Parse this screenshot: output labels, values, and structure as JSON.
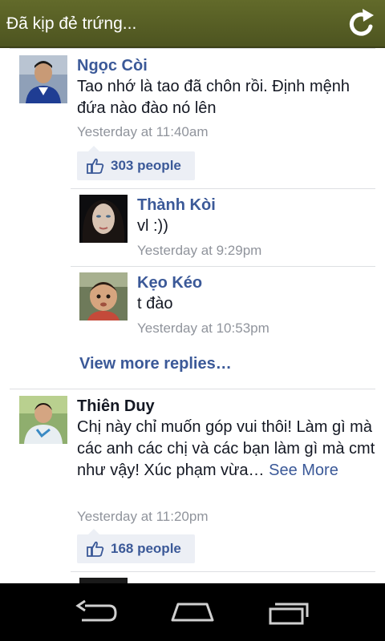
{
  "header": {
    "title": "Đã kịp đẻ trứng...",
    "refresh_icon": "refresh-icon"
  },
  "comments": [
    {
      "name": "Ngọc Còi",
      "text": "Tao nhớ là tao đã chôn rồi. Định mệnh đứa nào đào nó lên",
      "time": "Yesterday at 11:40am",
      "likes": "303 people"
    },
    {
      "name": "Thiên Duy",
      "text": "Chị này chỉ muốn góp vui thôi! Làm gì mà các anh các chị và các bạn làm gì mà cmt như vậy! Xúc phạm vừa…",
      "see_more": "See More",
      "time": "Yesterday at 11:20pm",
      "likes": "168 people"
    }
  ],
  "replies": [
    {
      "name": "Thành Kòi",
      "text": "vl :))",
      "time": "Yesterday at 9:29pm"
    },
    {
      "name": "Kẹo Kéo",
      "text": "t đào",
      "time": "Yesterday at 10:53pm"
    }
  ],
  "view_more_replies": "View more replies…",
  "navbar": {
    "back_icon": "back-icon",
    "home_icon": "home-icon",
    "recents_icon": "recent-apps-icon"
  },
  "colors": {
    "header_bg": "#5a6125",
    "link_blue": "#3b5998",
    "like_bg": "#eceff5",
    "nav_bg": "#000000"
  }
}
